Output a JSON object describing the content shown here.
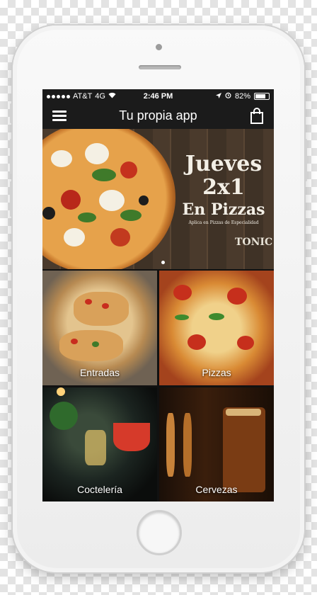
{
  "status_bar": {
    "carrier": "AT&T",
    "network": "4G",
    "time": "2:46 PM",
    "battery": "82%"
  },
  "nav": {
    "title": "Tu propia app",
    "menu_icon": "hamburger-menu-icon",
    "cart_icon": "shopping-bag-icon"
  },
  "banner": {
    "line1": "Jueves",
    "line2": "2x1",
    "line3": "En Pizzas",
    "subtitle": "Aplica en Pizzas de Especialidad",
    "brand": "TONIC"
  },
  "categories": [
    {
      "label": "Entradas"
    },
    {
      "label": "Pizzas"
    },
    {
      "label": "Coctelería"
    },
    {
      "label": "Cervezas"
    }
  ],
  "colors": {
    "nav_background": "#1b1b1b",
    "wood": "#4a3a2c"
  }
}
